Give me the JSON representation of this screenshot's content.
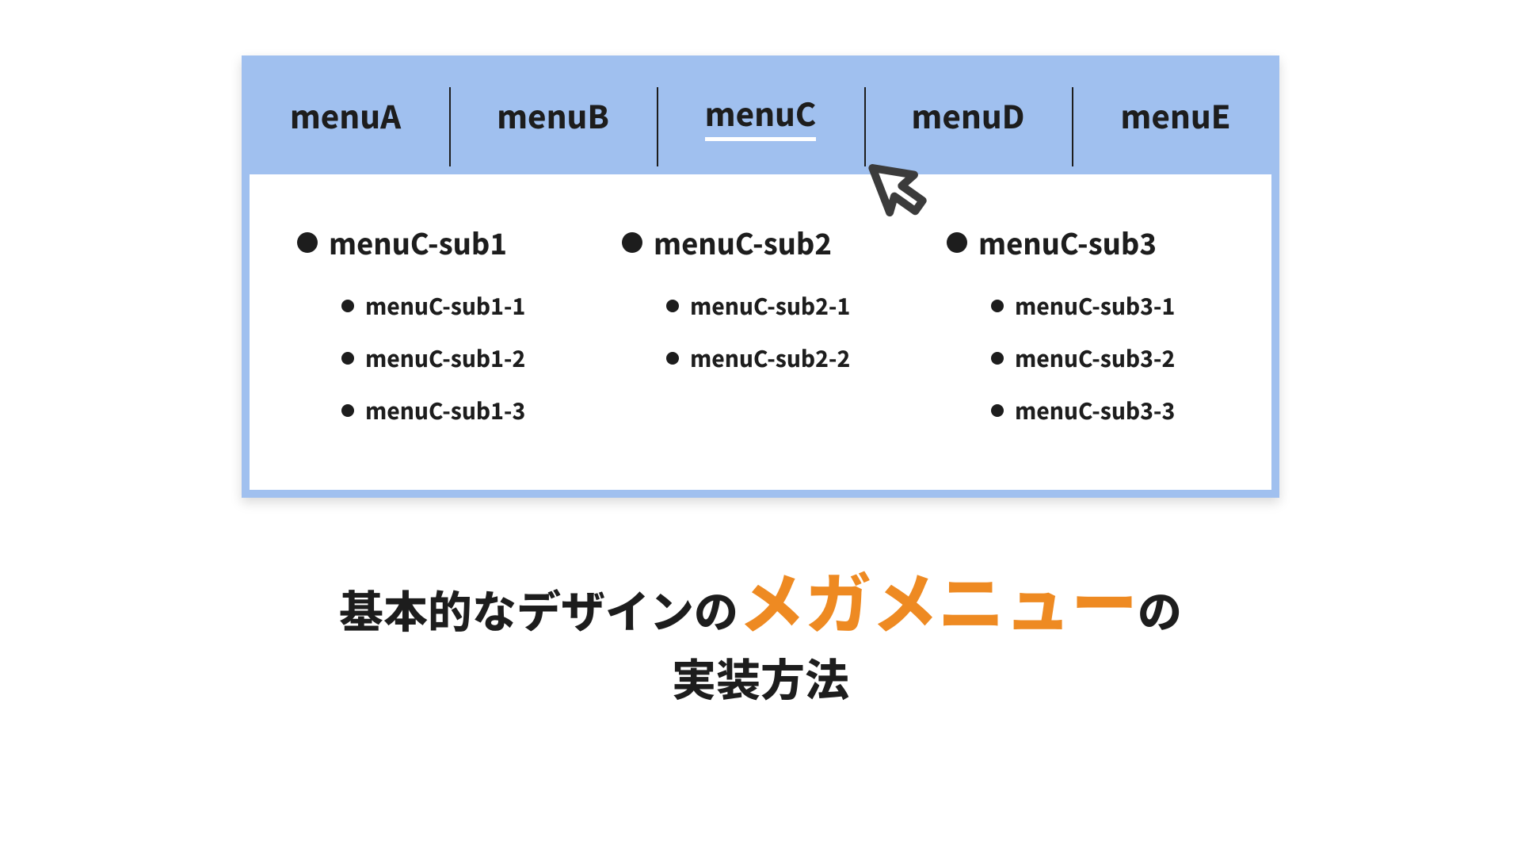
{
  "colors": {
    "nav_bg": "#a0c0ef",
    "text": "#1d1d1d",
    "accent": "#ee8a22"
  },
  "nav": {
    "active_index": 2,
    "items": [
      {
        "label": "menuA"
      },
      {
        "label": "menuB"
      },
      {
        "label": "menuC"
      },
      {
        "label": "menuD"
      },
      {
        "label": "menuE"
      }
    ]
  },
  "panel": {
    "columns": [
      {
        "title": "menuC-sub1",
        "items": [
          "menuC-sub1-1",
          "menuC-sub1-2",
          "menuC-sub1-3"
        ]
      },
      {
        "title": "menuC-sub2",
        "items": [
          "menuC-sub2-1",
          "menuC-sub2-2"
        ]
      },
      {
        "title": "menuC-sub3",
        "items": [
          "menuC-sub3-1",
          "menuC-sub3-2",
          "menuC-sub3-3"
        ]
      }
    ]
  },
  "cursor_icon": "cursor-hand-icon",
  "caption": {
    "part1": "基本的なデザインの",
    "highlight": "メガメニュー",
    "part2": "の",
    "line2": "実装方法"
  }
}
